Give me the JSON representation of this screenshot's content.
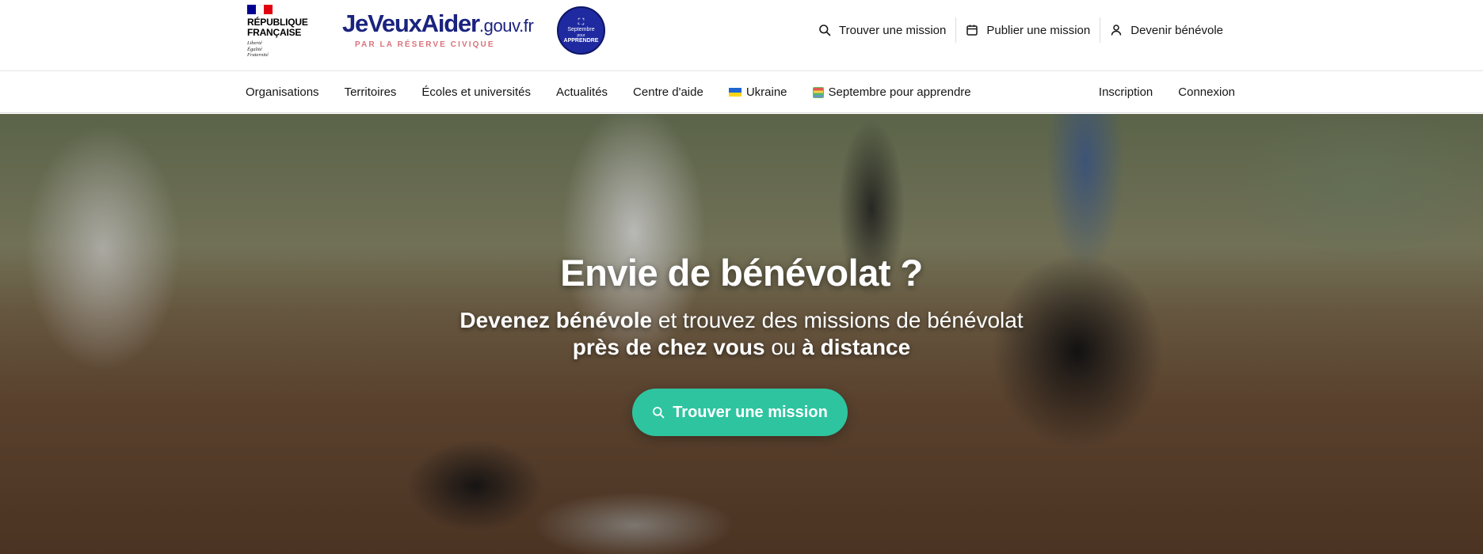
{
  "header": {
    "gov_logo": {
      "name": "République\nFrançaise",
      "motto": "Liberté\nÉgalité\nFraternité"
    },
    "brand": {
      "main": "JeVeuxAider",
      "tld": ".gouv.fr",
      "tagline": "PAR LA RÉSERVE CIVIQUE"
    },
    "badge": {
      "line1": "Septembre",
      "line2": "pour",
      "line3": "APPRENDRE"
    },
    "actions": [
      {
        "label": "Trouver une mission",
        "icon": "search-icon"
      },
      {
        "label": "Publier une mission",
        "icon": "calendar-icon"
      },
      {
        "label": "Devenir bénévole",
        "icon": "user-icon"
      }
    ]
  },
  "nav": {
    "left": [
      {
        "label": "Organisations"
      },
      {
        "label": "Territoires"
      },
      {
        "label": "Écoles et universités"
      },
      {
        "label": "Actualités"
      },
      {
        "label": "Centre d'aide"
      },
      {
        "label": "Ukraine",
        "icon": "ukraine-flag-icon"
      },
      {
        "label": "Septembre pour apprendre",
        "icon": "calendar-color-icon"
      }
    ],
    "right": [
      {
        "label": "Inscription"
      },
      {
        "label": "Connexion"
      }
    ]
  },
  "hero": {
    "title": "Envie de bénévolat ?",
    "subtitle": {
      "strong1": "Devenez bénévole",
      "text1": " et trouvez des missions de bénévolat",
      "strong2": "près de chez vous",
      "text2": " ou ",
      "strong3": "à distance"
    },
    "cta_label": "Trouver une mission"
  },
  "colors": {
    "brand_blue": "#1a237e",
    "brand_pink": "#d9737b",
    "cta_green": "#2ec4a0",
    "badge_blue": "#1f2aa0"
  }
}
